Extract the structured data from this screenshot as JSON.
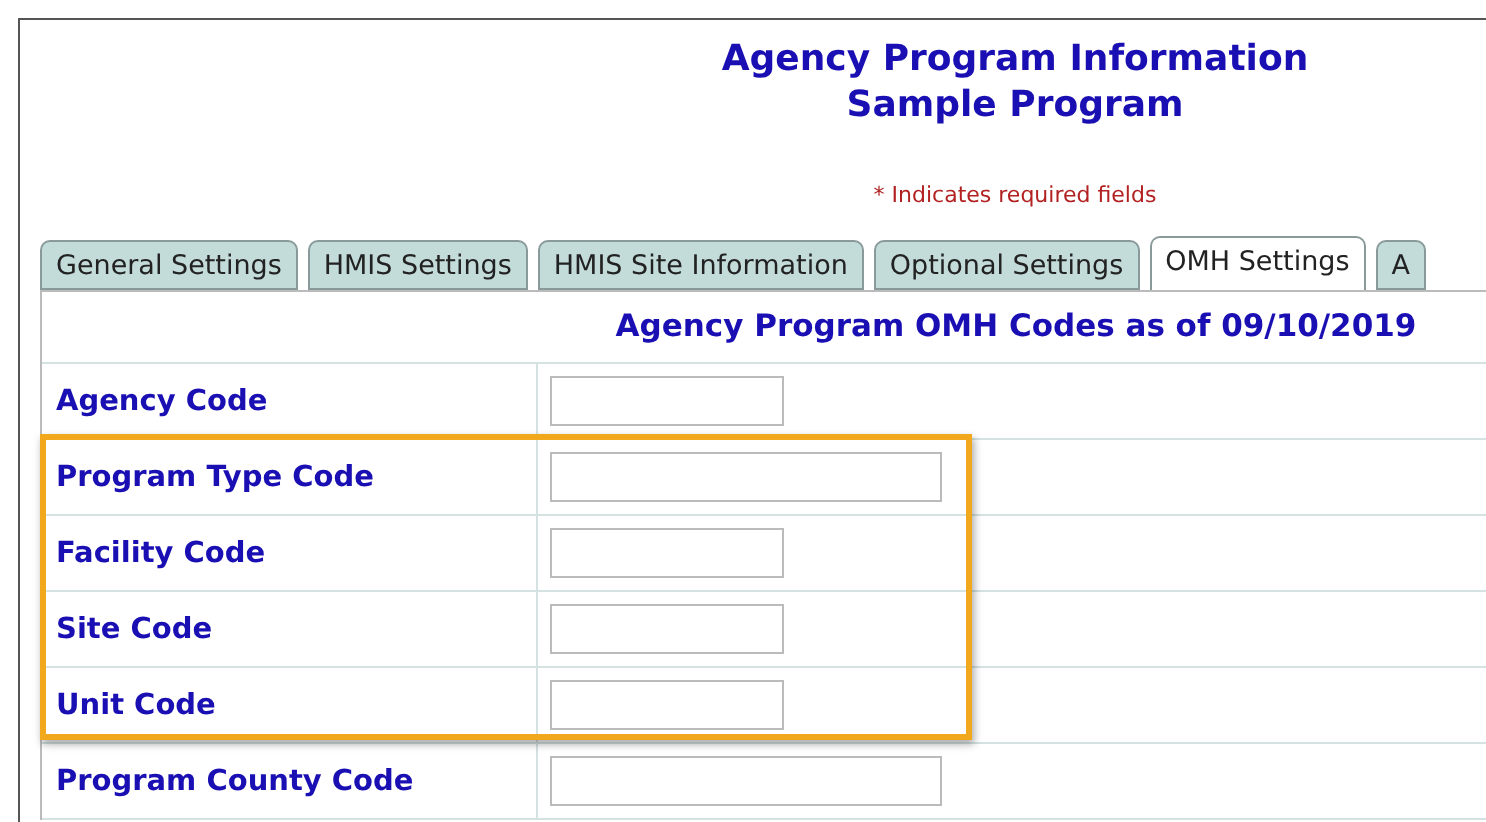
{
  "title": {
    "line_1": "Agency Program Information",
    "line_2": "Sample Program"
  },
  "required_note": "* Indicates required fields",
  "tabs": [
    {
      "label": "General Settings",
      "selected": false
    },
    {
      "label": "HMIS Settings",
      "selected": false
    },
    {
      "label": "HMIS Site Information",
      "selected": false
    },
    {
      "label": "Optional Settings",
      "selected": false
    },
    {
      "label": "OMH Settings",
      "selected": true
    },
    {
      "label": "A",
      "selected": false
    }
  ],
  "table": {
    "heading": "Agency Program OMH Codes as of 09/10/2019",
    "rows": [
      {
        "label": "Agency Code",
        "kind": "short",
        "highlighted": false
      },
      {
        "label": "Program Type Code",
        "kind": "long",
        "highlighted": true
      },
      {
        "label": "Facility Code",
        "kind": "short",
        "highlighted": true
      },
      {
        "label": "Site Code",
        "kind": "short",
        "highlighted": true
      },
      {
        "label": "Unit Code",
        "kind": "short",
        "highlighted": true
      },
      {
        "label": "Program County Code",
        "kind": "long",
        "highlighted": false
      }
    ]
  }
}
